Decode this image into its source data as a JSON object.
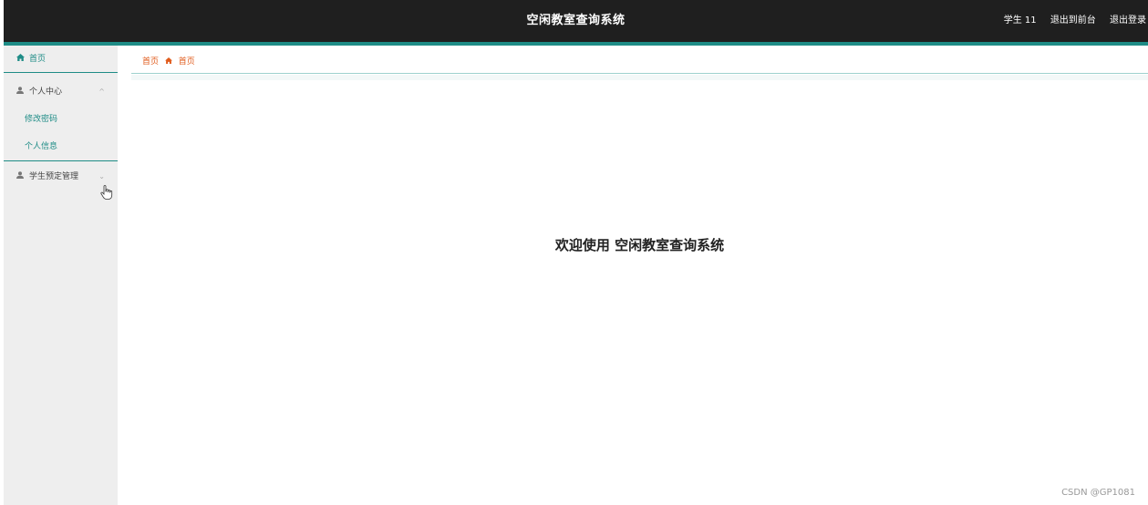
{
  "header": {
    "title": "空闲教室查询系统",
    "user": "学生 11",
    "back_to_front": "退出到前台",
    "logout": "退出登录",
    "accent_color": "#1e8c86"
  },
  "sidebar": {
    "home": {
      "label": "首页",
      "icon": "home-icon"
    },
    "personal_center": {
      "label": "个人中心",
      "icon": "user-icon",
      "expanded": true,
      "items": [
        "修改密码",
        "个人信息"
      ]
    },
    "booking_management": {
      "label": "学生预定管理",
      "icon": "user-icon",
      "expanded": false
    }
  },
  "breadcrumb": {
    "root": "首页",
    "current": "首页"
  },
  "main": {
    "welcome": "欢迎使用 空闲教室查询系统"
  },
  "watermark": "CSDN @GP1081"
}
